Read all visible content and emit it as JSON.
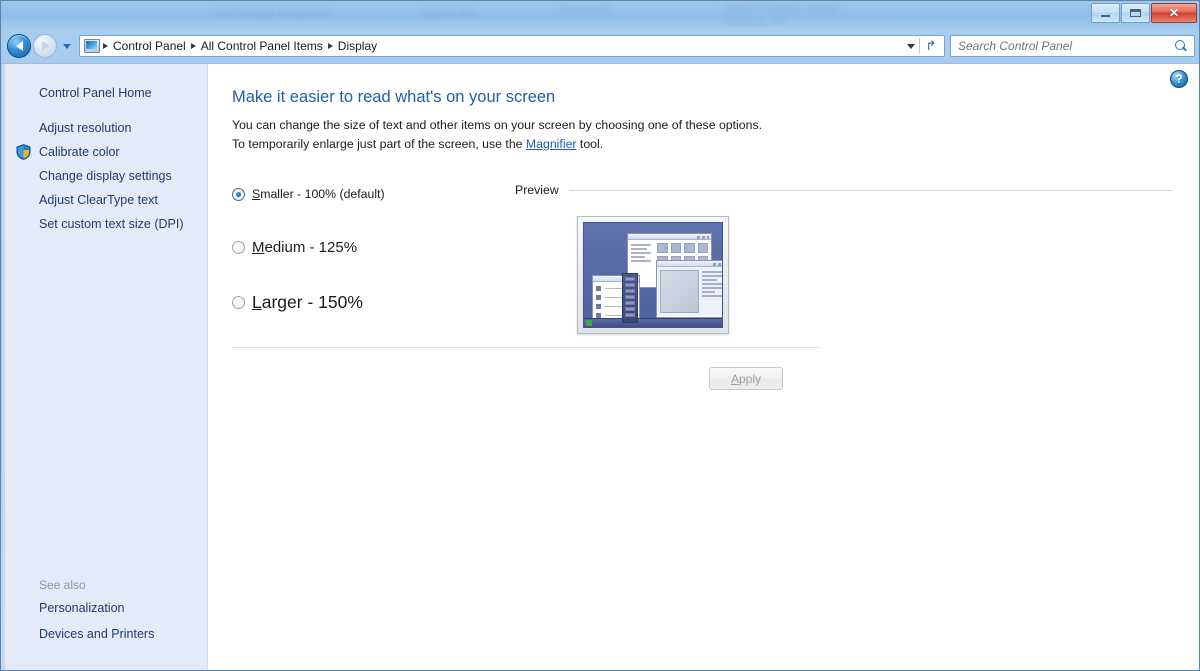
{
  "window": {
    "ghost_texts": [
      "Set Default Programs",
      "Search Box",
      "Remove All",
      "Default Programs Settings",
      "Window XP"
    ],
    "controls": {
      "minimize": "minimize-button",
      "maximize": "maximize-button",
      "close_label": "✕"
    }
  },
  "nav": {
    "back_label": "Back",
    "forward_label": "Forward",
    "recent_pages_label": "Recent pages",
    "refresh_label": "↱",
    "breadcrumbs": [
      "Control Panel",
      "All Control Panel Items",
      "Display"
    ],
    "address_icon": "control-panel-icon"
  },
  "search": {
    "placeholder": "Search Control Panel",
    "value": "",
    "icon": "search-icon"
  },
  "help": {
    "label": "?"
  },
  "sidebar": {
    "home_label": "Control Panel Home",
    "items": [
      {
        "label": "Adjust resolution",
        "shield": false
      },
      {
        "label": "Calibrate color",
        "shield": true
      },
      {
        "label": "Change display settings",
        "shield": false
      },
      {
        "label": "Adjust ClearType text",
        "shield": false
      },
      {
        "label": "Set custom text size (DPI)",
        "shield": false
      }
    ],
    "see_also_header": "See also",
    "see_also": [
      "Personalization",
      "Devices and Printers"
    ]
  },
  "main": {
    "heading": "Make it easier to read what's on your screen",
    "description_part1": "You can change the size of text and other items on your screen by choosing one of these options. To temporarily enlarge just part of the screen, use the ",
    "description_link": "Magnifier",
    "description_part2": " tool.",
    "options": [
      {
        "accel": "S",
        "rest": "maller - 100% (default)",
        "selected": true
      },
      {
        "accel": "M",
        "rest": "edium - 125%",
        "selected": false
      },
      {
        "accel": "L",
        "rest": "arger - 150%",
        "selected": false
      }
    ],
    "preview_label": "Preview",
    "preview_alt": "desktop-preview-thumbnail",
    "apply": {
      "accel": "A",
      "rest": "pply",
      "disabled": true
    }
  },
  "colors": {
    "accent": "#1f5fad",
    "link": "#1c5fad",
    "sidebar_bg": "#e3eaf8",
    "heading": "#1f5fad"
  }
}
